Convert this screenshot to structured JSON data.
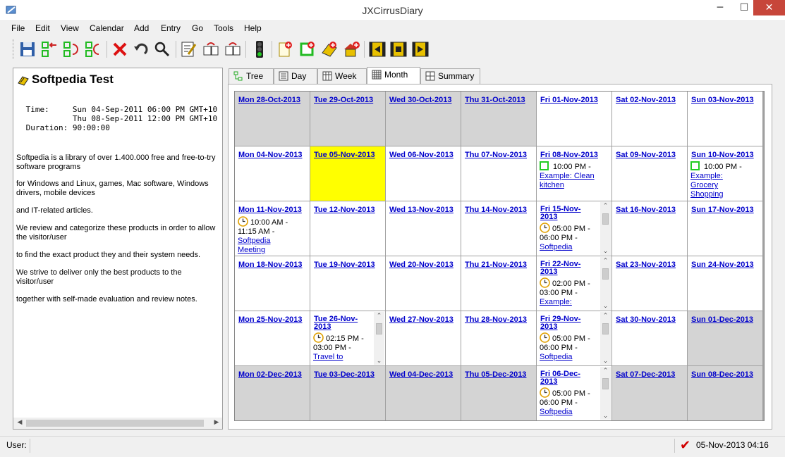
{
  "window": {
    "title": "JXCirrusDiary",
    "min": "─",
    "max": "☐",
    "close": "✕"
  },
  "menu": [
    "File",
    "Edit",
    "View",
    "Calendar",
    "Add",
    "Entry",
    "Go",
    "Tools",
    "Help"
  ],
  "toolbar": {
    "icons": [
      "save-icon",
      "new-entry-icon",
      "sync-icon",
      "copy-entry-icon",
      "delete-icon",
      "undo-icon",
      "search-icon",
      "edit-icon",
      "move-in-icon",
      "move-out-icon",
      "traffic-light-icon",
      "add-note-icon",
      "add-event-icon",
      "add-diary-icon",
      "add-home-icon",
      "film-prev-icon",
      "film-icon",
      "film-next-icon"
    ]
  },
  "entry": {
    "title": "Softpedia Test",
    "time_label": "Time:",
    "time_start": "Sun 04-Sep-2011 06:00 PM GMT+10",
    "time_end": "Thu 08-Sep-2011 12:00 PM GMT+10",
    "duration_label": "Duration:",
    "duration": "90:00:00",
    "paragraphs": [
      "Softpedia is a library of over 1.400.000 free and free-to-try software programs",
      "for Windows and Linux, games, Mac software, Windows drivers, mobile devices",
      "and IT-related articles.",
      "We review and categorize these products in order to allow the visitor/user",
      "to find the exact product they and their system needs.",
      "We strive to deliver only the best products to the visitor/user",
      "together with self-made evaluation and review notes."
    ]
  },
  "tabs": [
    "Tree",
    "Day",
    "Week",
    "Month",
    "Summary"
  ],
  "active_tab": "Month",
  "calendar": {
    "weeks": [
      [
        {
          "date": "Mon 28-Oct-2013",
          "other": true
        },
        {
          "date": "Tue 29-Oct-2013",
          "other": true
        },
        {
          "date": "Wed 30-Oct-2013",
          "other": true
        },
        {
          "date": "Thu 31-Oct-2013",
          "other": true
        },
        {
          "date": "Fri 01-Nov-2013"
        },
        {
          "date": "Sat 02-Nov-2013"
        },
        {
          "date": "Sun 03-Nov-2013"
        }
      ],
      [
        {
          "date": "Mon 04-Nov-2013"
        },
        {
          "date": "Tue 05-Nov-2013",
          "today": true
        },
        {
          "date": "Wed 06-Nov-2013"
        },
        {
          "date": "Thu 07-Nov-2013"
        },
        {
          "date": "Fri 08-Nov-2013",
          "event": {
            "kind": "task",
            "time": "10:00 PM -",
            "title": "Example: Clean kitchen"
          }
        },
        {
          "date": "Sat 09-Nov-2013"
        },
        {
          "date": "Sun 10-Nov-2013",
          "event": {
            "kind": "task",
            "time": "10:00 PM -",
            "title": "Example: Grocery Shopping"
          }
        }
      ],
      [
        {
          "date": "Mon 11-Nov-2013",
          "event": {
            "kind": "appt",
            "time": "10:00 AM -",
            "time2": "11:15 AM -",
            "title": "Softpedia Meeting"
          }
        },
        {
          "date": "Tue 12-Nov-2013"
        },
        {
          "date": "Wed 13-Nov-2013"
        },
        {
          "date": "Thu 14-Nov-2013"
        },
        {
          "date": "Fri 15-Nov-2013",
          "wrap": true,
          "scroll": true,
          "event": {
            "kind": "appt",
            "time": "05:00 PM -",
            "time2": "06:00 PM -",
            "title": "Softpedia"
          }
        },
        {
          "date": "Sat 16-Nov-2013"
        },
        {
          "date": "Sun 17-Nov-2013"
        }
      ],
      [
        {
          "date": "Mon 18-Nov-2013"
        },
        {
          "date": "Tue 19-Nov-2013"
        },
        {
          "date": "Wed 20-Nov-2013"
        },
        {
          "date": "Thu 21-Nov-2013"
        },
        {
          "date": "Fri 22-Nov-2013",
          "wrap": true,
          "scroll": true,
          "event": {
            "kind": "appt",
            "time": "02:00 PM -",
            "time2": "03:00 PM -",
            "title": "Example:"
          }
        },
        {
          "date": "Sat 23-Nov-2013"
        },
        {
          "date": "Sun 24-Nov-2013"
        }
      ],
      [
        {
          "date": "Mon 25-Nov-2013"
        },
        {
          "date": "Tue 26-Nov-2013",
          "wrap": true,
          "scroll": true,
          "event": {
            "kind": "appt",
            "time": "02:15 PM -",
            "time2": "03:00 PM -",
            "title": "Travel to"
          }
        },
        {
          "date": "Wed 27-Nov-2013"
        },
        {
          "date": "Thu 28-Nov-2013"
        },
        {
          "date": "Fri 29-Nov-2013",
          "wrap": true,
          "scroll": true,
          "event": {
            "kind": "appt",
            "time": "05:00 PM -",
            "time2": "06:00 PM -",
            "title": "Softpedia"
          }
        },
        {
          "date": "Sat 30-Nov-2013"
        },
        {
          "date": "Sun 01-Dec-2013",
          "other": true
        }
      ],
      [
        {
          "date": "Mon 02-Dec-2013",
          "other": true
        },
        {
          "date": "Tue 03-Dec-2013",
          "other": true
        },
        {
          "date": "Wed 04-Dec-2013",
          "other": true
        },
        {
          "date": "Thu 05-Dec-2013",
          "other": true
        },
        {
          "date": "Fri 06-Dec-2013",
          "wrap": true,
          "scroll": true,
          "event": {
            "kind": "appt",
            "time": "05:00 PM -",
            "time2": "06:00 PM -",
            "title": "Softpedia"
          }
        },
        {
          "date": "Sat 07-Dec-2013",
          "other": true
        },
        {
          "date": "Sun 08-Dec-2013",
          "other": true
        }
      ]
    ]
  },
  "status": {
    "user_label": "User:",
    "datetime": "05-Nov-2013 04:16"
  },
  "colors": {
    "today": "#ffff00",
    "other_month": "#d4d4d4",
    "link": "#0000cc",
    "close_button": "#c7463a"
  }
}
